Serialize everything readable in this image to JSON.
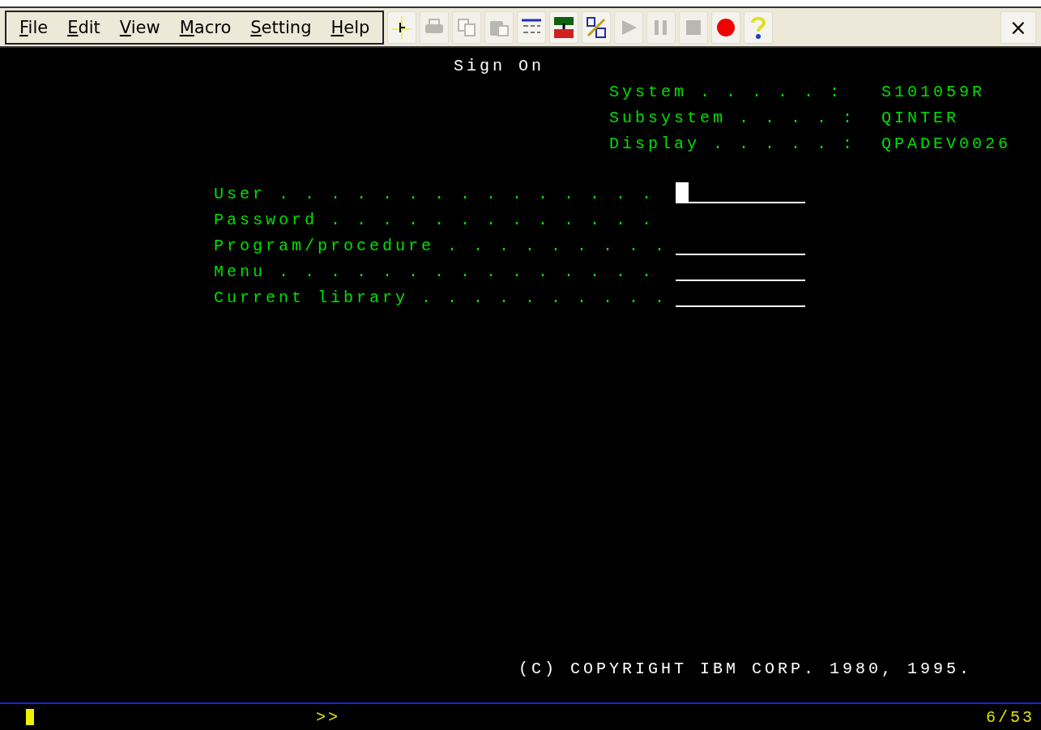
{
  "menu": [
    {
      "label": "File"
    },
    {
      "label": "Edit"
    },
    {
      "label": "View"
    },
    {
      "label": "Macro"
    },
    {
      "label": "Setting"
    },
    {
      "label": "Help"
    }
  ],
  "toolbar": [
    {
      "kind": "ruler",
      "disabled": false
    },
    {
      "kind": "print",
      "disabled": true
    },
    {
      "kind": "copy",
      "disabled": true
    },
    {
      "kind": "paste",
      "disabled": true
    },
    {
      "kind": "grid",
      "disabled": false
    },
    {
      "kind": "transfer",
      "disabled": false
    },
    {
      "kind": "keys",
      "disabled": false
    },
    {
      "kind": "play",
      "disabled": true
    },
    {
      "kind": "pause",
      "disabled": true
    },
    {
      "kind": "stop",
      "disabled": true
    },
    {
      "kind": "record",
      "disabled": false
    },
    {
      "kind": "help",
      "disabled": false
    }
  ],
  "close": "×",
  "screen": {
    "title": "Sign On",
    "system_info": [
      {
        "label": "System . . . . . :",
        "value": "S101059R"
      },
      {
        "label": "Subsystem . . . . :",
        "value": "QINTER"
      },
      {
        "label": "Display . . . . . :",
        "value": "QPADEV0026"
      }
    ],
    "fields": [
      {
        "label": "User . . . . . . . . . . . . . . .",
        "kind": "underlined",
        "cursor": true
      },
      {
        "label": "Password . . . . . . . . . . . . .",
        "kind": "hidden",
        "cursor": false
      },
      {
        "label": "Program/procedure . . . . . . . . .",
        "kind": "underlined",
        "cursor": false
      },
      {
        "label": "Menu . . . . . . . . . . . . . . .",
        "kind": "underlined",
        "cursor": false
      },
      {
        "label": "Current library . . . . . . . . . .",
        "kind": "underlined",
        "cursor": false
      }
    ],
    "copyright": "(C) COPYRIGHT IBM CORP. 1980, 1995."
  },
  "status_bar": {
    "cursor": true,
    "indicator": ">>",
    "position": "6/53"
  }
}
